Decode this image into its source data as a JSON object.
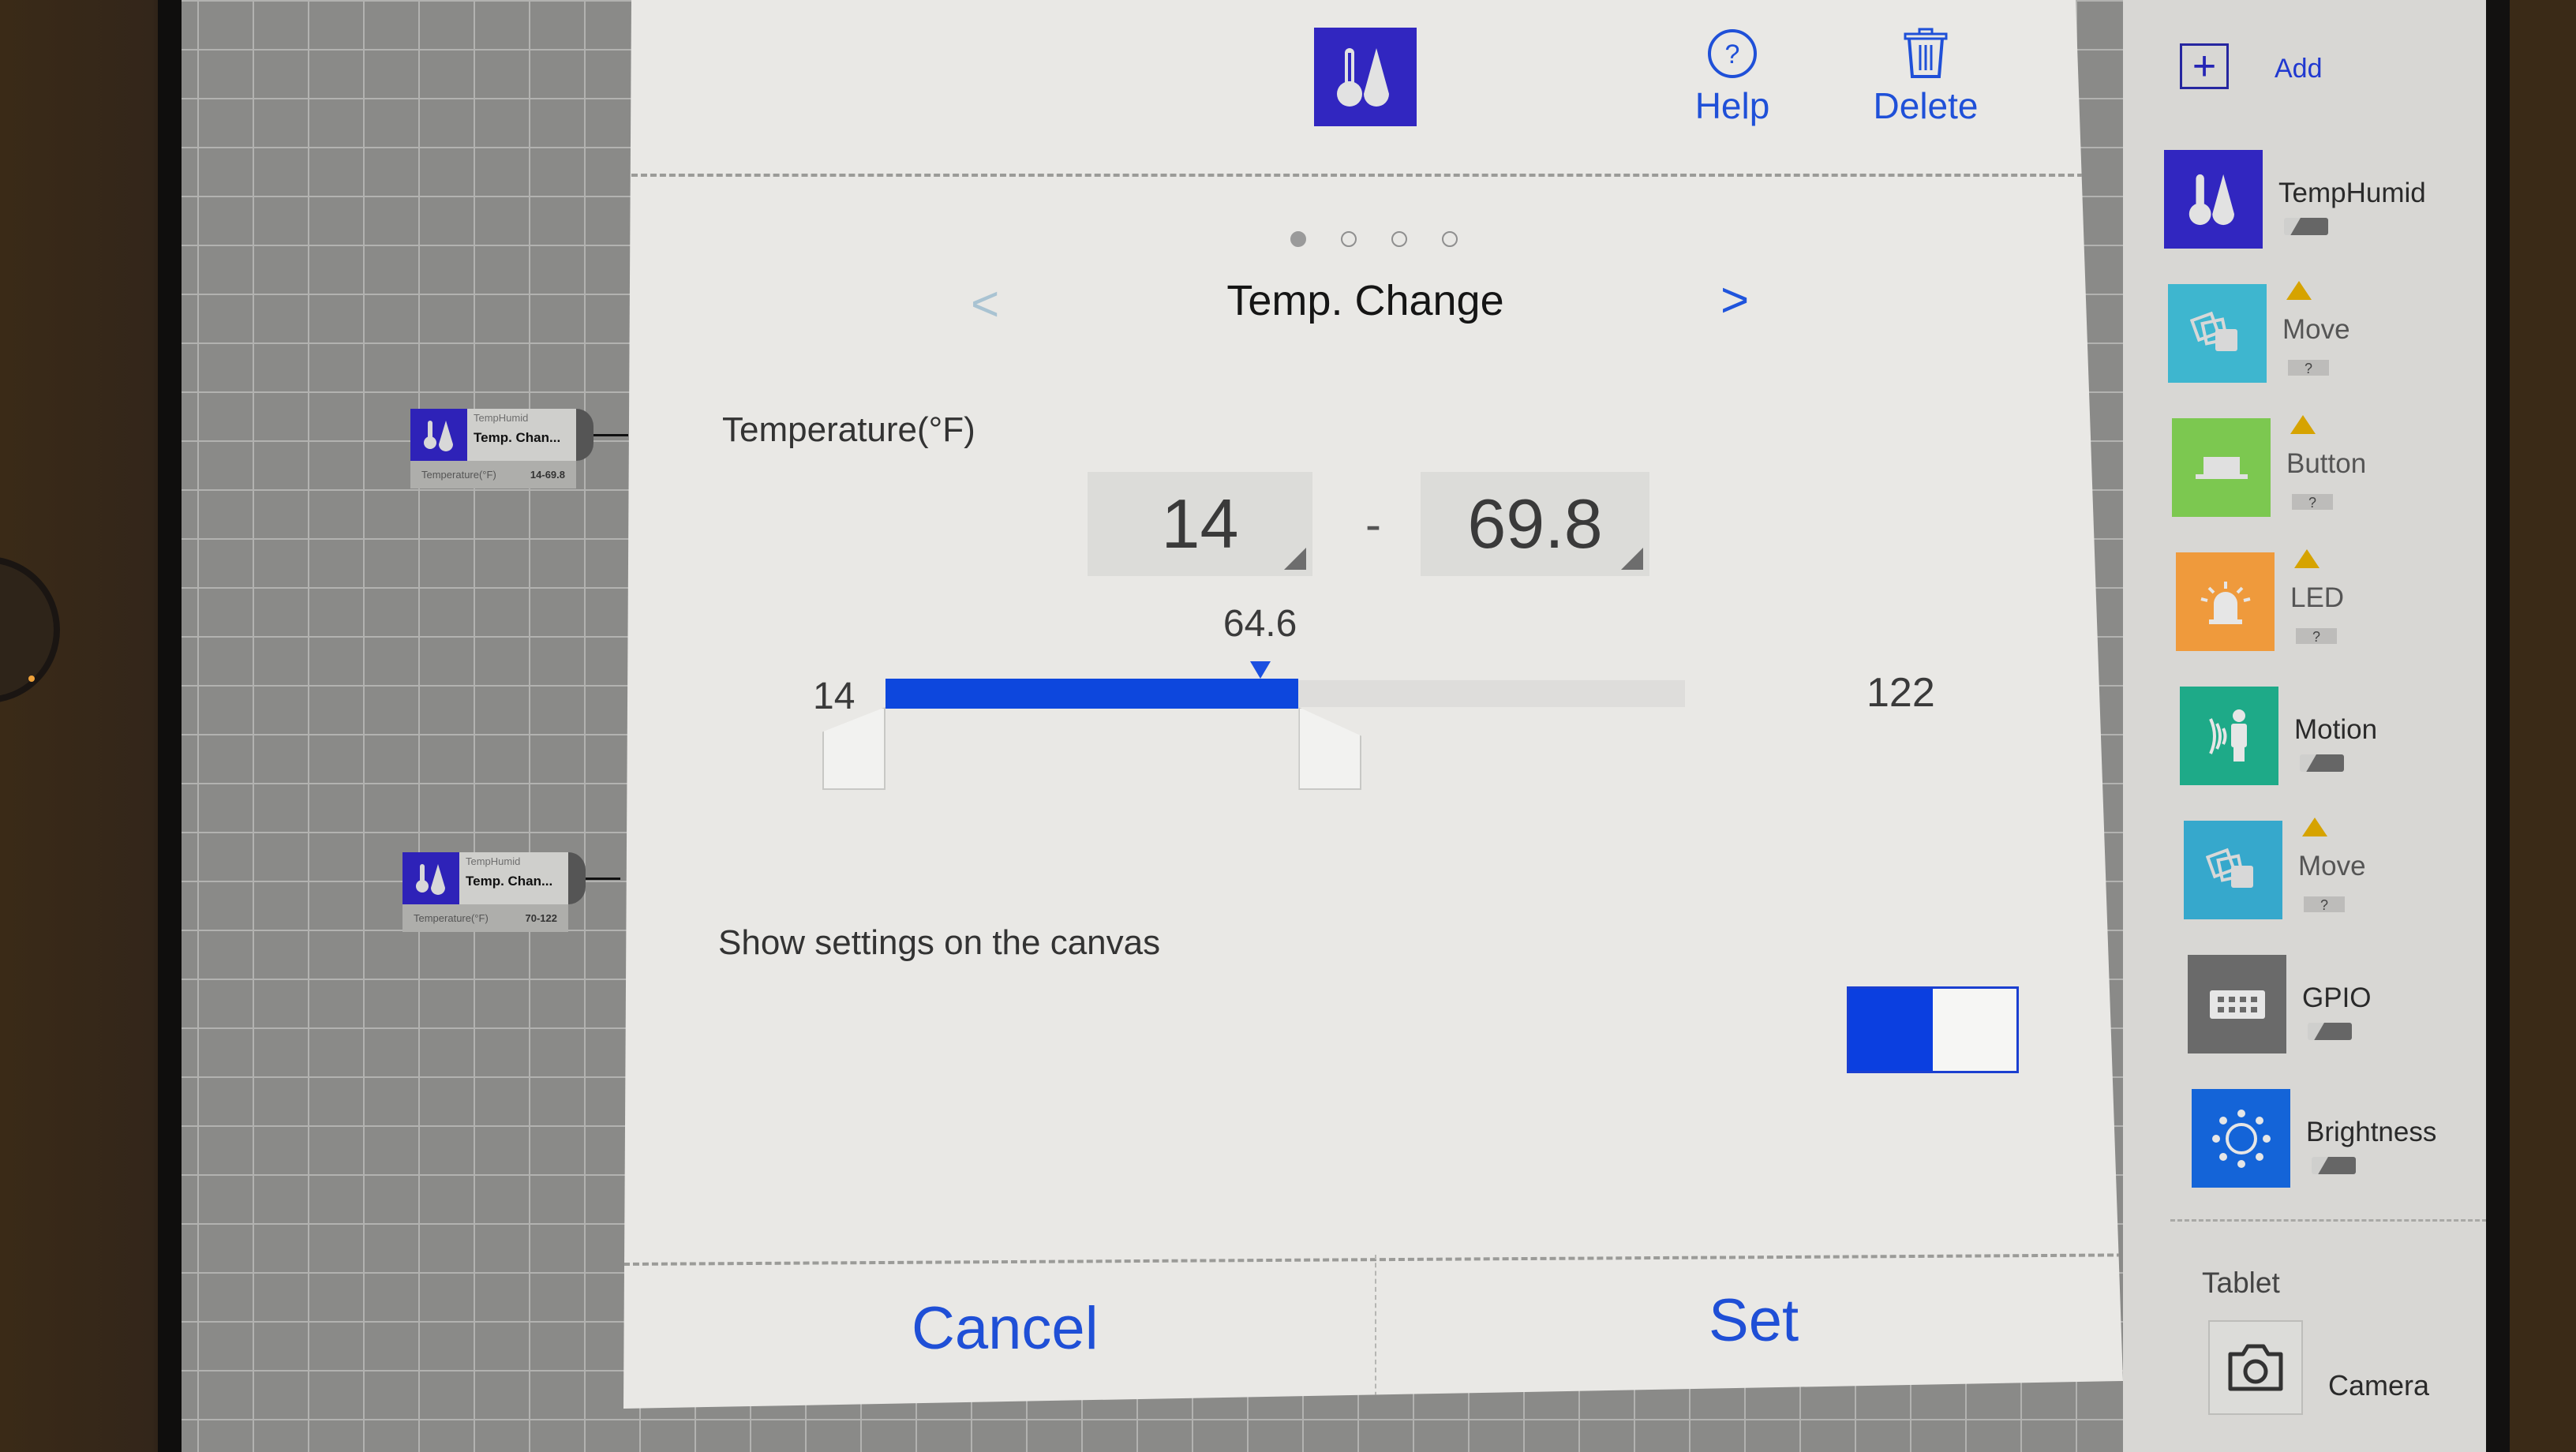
{
  "dialog": {
    "help_label": "Help",
    "delete_label": "Delete",
    "page_indicator": {
      "total": 4,
      "current": 1
    },
    "title": "Temp. Change",
    "prev_arrow": "<",
    "next_arrow": ">",
    "temperature_label": "Temperature(°F)",
    "range": {
      "low_value": "14",
      "separator": "-",
      "high_value": "69.8"
    },
    "slider": {
      "min_label": "14",
      "max_label": "122",
      "min": 14,
      "max": 122,
      "range_low": 14,
      "range_high": 69.8,
      "current_value_label": "64.6",
      "current_value": 64.6,
      "fill_color": "#0d47dd"
    },
    "show_settings_label": "Show settings on the canvas",
    "show_settings_on": true,
    "cancel_label": "Cancel",
    "set_label": "Set",
    "accent_color": "#1f4fd6"
  },
  "canvas": {
    "nodes": [
      {
        "device": "TempHumid",
        "name": "Temp. Chan...",
        "param_label": "Temperature(°F)",
        "param_value": "14-69.8"
      },
      {
        "device": "TempHumid",
        "name": "Temp. Chan...",
        "param_label": "Temperature(°F)",
        "param_value": "70-122"
      }
    ]
  },
  "sidebar": {
    "add_label": "Add",
    "items": [
      {
        "name": "TempHumid",
        "icon": "thermometer-droplet-icon",
        "color": "#3126c0",
        "warning": false,
        "status": "battery"
      },
      {
        "name": "Move",
        "icon": "move-cards-icon",
        "color": "#3eb6cf",
        "warning": true,
        "status": "?"
      },
      {
        "name": "Button",
        "icon": "button-icon",
        "color": "#7cc850",
        "warning": true,
        "status": "?"
      },
      {
        "name": "LED",
        "icon": "led-siren-icon",
        "color": "#ef9a3c",
        "warning": true,
        "status": "?"
      },
      {
        "name": "Motion",
        "icon": "motion-person-icon",
        "color": "#1eaa88",
        "warning": false,
        "status": "battery"
      },
      {
        "name": "Move",
        "icon": "move-cards-icon",
        "color": "#36a8cc",
        "warning": true,
        "status": "?"
      },
      {
        "name": "GPIO",
        "icon": "gpio-connector-icon",
        "color": "#6a6a6a",
        "warning": false,
        "status": "battery"
      },
      {
        "name": "Brightness",
        "icon": "brightness-sun-icon",
        "color": "#1464d8",
        "warning": false,
        "status": "battery"
      }
    ],
    "section_label": "Tablet",
    "tablet_items": [
      {
        "name": "Camera",
        "icon": "camera-icon"
      }
    ]
  }
}
